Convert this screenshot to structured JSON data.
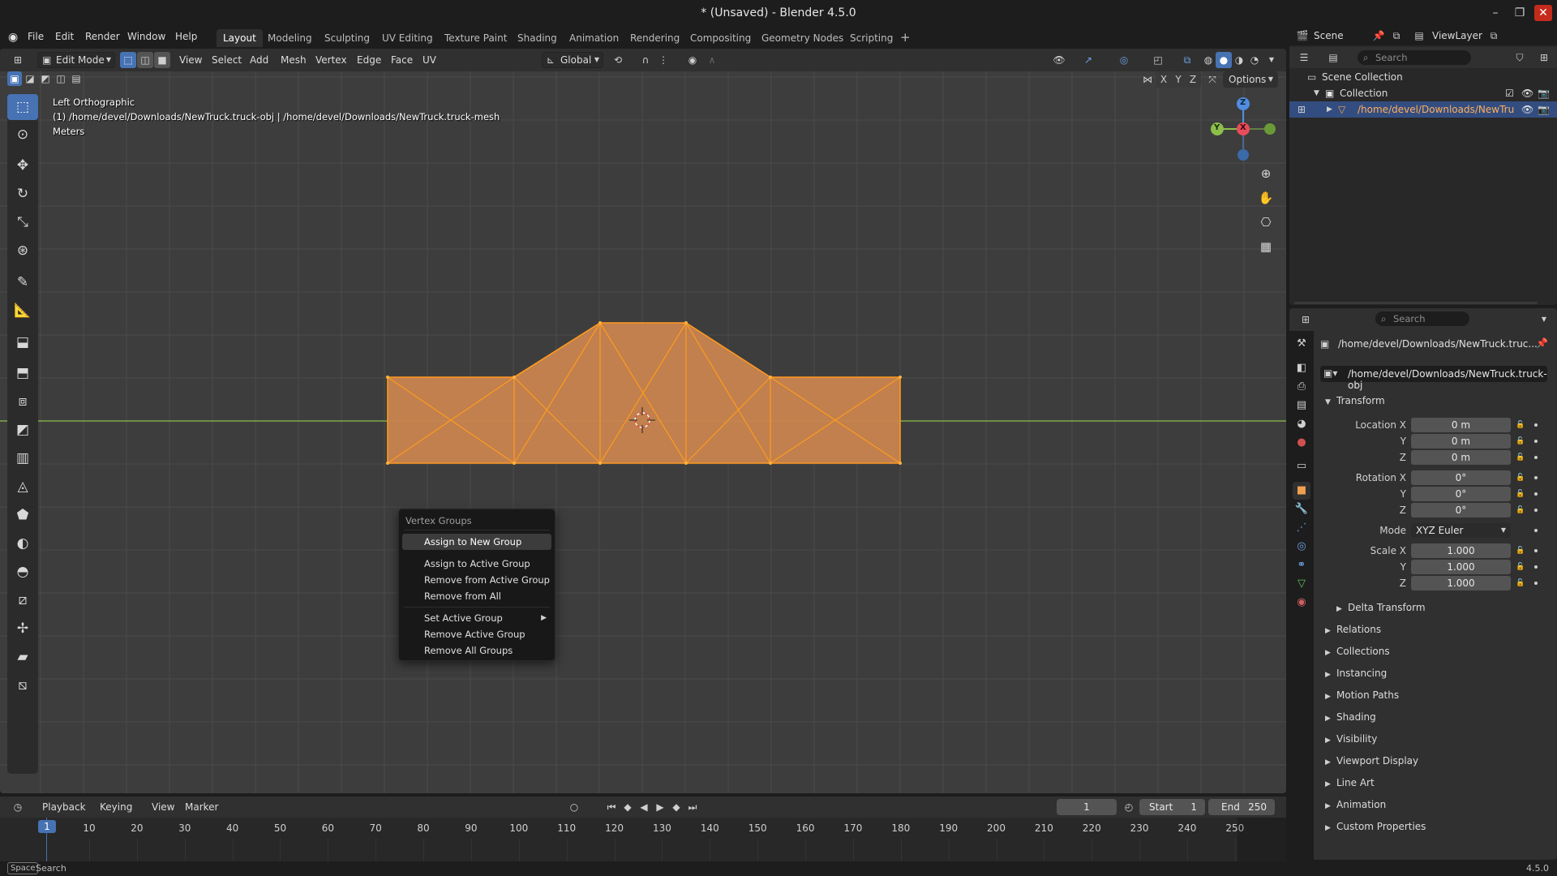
{
  "window": {
    "title": "* (Unsaved) - Blender 4.5.0"
  },
  "menubar": {
    "menus": [
      "File",
      "Edit",
      "Render",
      "Window",
      "Help"
    ],
    "workspaces": [
      "Layout",
      "Modeling",
      "Sculpting",
      "UV Editing",
      "Texture Paint",
      "Shading",
      "Animation",
      "Rendering",
      "Compositing",
      "Geometry Nodes",
      "Scripting"
    ],
    "active_workspace": "Layout"
  },
  "viewport": {
    "mode": "Edit Mode",
    "header_menus": [
      "View",
      "Select",
      "Add",
      "Mesh",
      "Vertex",
      "Edge",
      "Face",
      "UV"
    ],
    "transform_orientation": "Global",
    "options_label": "Options",
    "mirror_axes": [
      "X",
      "Y",
      "Z"
    ],
    "view_name": "Left Orthographic",
    "object_info": "(1) /home/devel/Downloads/NewTruck.truck-obj | /home/devel/Downloads/NewTruck.truck-mesh",
    "units": "Meters",
    "gizmo_axes": [
      "Z",
      "Y",
      "X"
    ]
  },
  "context_menu": {
    "title": "Vertex Groups",
    "items": [
      {
        "label": "Assign to New Group",
        "highlighted": true
      },
      {
        "label": "Assign to Active Group"
      },
      {
        "label": "Remove from Active Group"
      },
      {
        "label": "Remove from All"
      },
      {
        "label": "Set Active Group",
        "submenu": true
      },
      {
        "label": "Remove Active Group"
      },
      {
        "label": "Remove All Groups"
      }
    ]
  },
  "timeline": {
    "menus": [
      "Playback",
      "Keying",
      "View",
      "Marker"
    ],
    "current_frame": "1",
    "start_label": "Start",
    "start": "1",
    "end_label": "End",
    "end": "250",
    "ruler": [
      "1",
      "10",
      "20",
      "30",
      "40",
      "50",
      "60",
      "70",
      "80",
      "90",
      "100",
      "110",
      "120",
      "130",
      "140",
      "150",
      "160",
      "170",
      "180",
      "190",
      "200",
      "210",
      "220",
      "230",
      "240",
      "250"
    ]
  },
  "statusbar": {
    "key": "Space",
    "action": "Search",
    "version": "4.5.0"
  },
  "outliner": {
    "scene": "Scene",
    "view_layer": "ViewLayer",
    "search_placeholder": "Search",
    "rows": [
      "Scene Collection",
      "Collection",
      "/home/devel/Downloads/NewTru"
    ]
  },
  "properties": {
    "search_placeholder": "Search",
    "object_path": "/home/devel/Downloads/NewTruck.truc...",
    "object_name": "/home/devel/Downloads/NewTruck.truck-obj",
    "transform_title": "Transform",
    "location_label": "Location X",
    "rotation_label": "Rotation X",
    "scale_label": "Scale X",
    "y_label": "Y",
    "z_label": "Z",
    "location": [
      "0 m",
      "0 m",
      "0 m"
    ],
    "rotation": [
      "0°",
      "0°",
      "0°"
    ],
    "mode_label": "Mode",
    "mode_value": "XYZ Euler",
    "scale": [
      "1.000",
      "1.000",
      "1.000"
    ],
    "delta_transform": "Delta Transform",
    "panels": [
      "Relations",
      "Collections",
      "Instancing",
      "Motion Paths",
      "Shading",
      "Visibility",
      "Viewport Display",
      "Line Art",
      "Animation",
      "Custom Properties"
    ]
  },
  "colors": {
    "accent": "#4772b3",
    "mesh_face": "#c8844e",
    "mesh_edge": "#ff9a1f",
    "x_axis": "#e74c5a",
    "y_axis": "#8cbf4a",
    "z_axis": "#4f8ee0"
  }
}
